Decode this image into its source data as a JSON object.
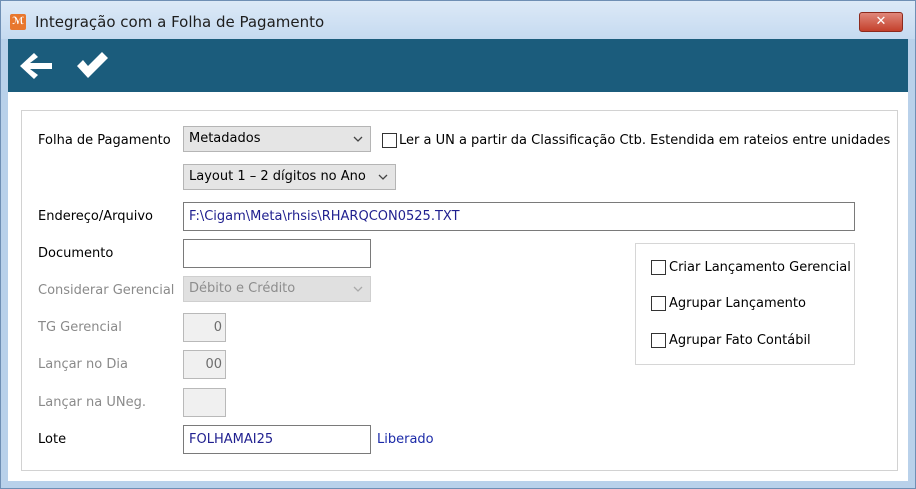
{
  "window": {
    "title": "Integração com a Folha de Pagamento",
    "close_label": "✕"
  },
  "icons": {
    "app": "app-logo-icon",
    "back": "arrow-left-icon",
    "confirm": "checkmark-icon",
    "chevron": "chevron-down-icon"
  },
  "colors": {
    "toolbar": "#1b5c7c",
    "link": "#1b2aa8",
    "input_text": "#1f1f8f"
  },
  "form": {
    "folha": {
      "label": "Folha de Pagamento",
      "value": "Metadados"
    },
    "ler_un": {
      "label": "Ler a UN a partir da Classificação Ctb. Estendida em rateios entre unidades",
      "checked": false
    },
    "layout": {
      "value": "Layout 1 – 2 dígitos no Ano"
    },
    "endereco": {
      "label": "Endereço/Arquivo",
      "value": "F:\\Cigam\\Meta\\rhsis\\RHARQCON0525.TXT"
    },
    "documento": {
      "label": "Documento",
      "value": ""
    },
    "considerar": {
      "label": "Considerar Gerencial",
      "value": "Débito e Crédito"
    },
    "tg": {
      "label": "TG Gerencial",
      "value": "0"
    },
    "dia": {
      "label": "Lançar no Dia",
      "value": "00"
    },
    "uneg": {
      "label": "Lançar na UNeg.",
      "value": ""
    },
    "lote": {
      "label": "Lote",
      "value": "FOLHAMAI25",
      "status": "Liberado"
    }
  },
  "options": {
    "criar": {
      "label": "Criar Lançamento Gerencial",
      "checked": false
    },
    "agrupar": {
      "label": "Agrupar Lançamento",
      "checked": false
    },
    "fato": {
      "label": "Agrupar Fato Contábil",
      "checked": false
    }
  }
}
